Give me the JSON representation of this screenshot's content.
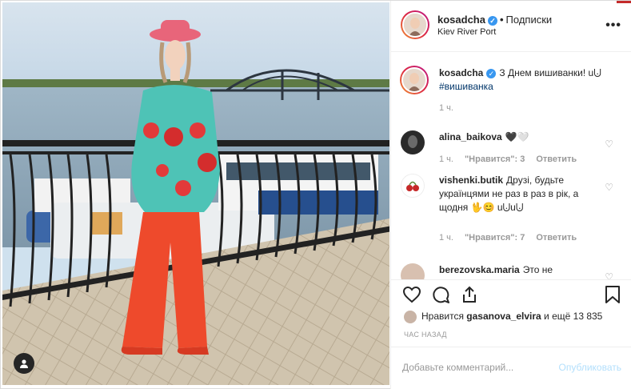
{
  "header": {
    "username": "kosadcha",
    "separator": "•",
    "follow_status": "Подписки",
    "location": "Kiev River Port",
    "more_label": "•••"
  },
  "caption": {
    "username": "kosadcha",
    "text": "З Днем вишиванки! u⨃",
    "hashtag": "#вишиванка",
    "time": "1 ч."
  },
  "comments": [
    {
      "username": "alina_baikova",
      "text": "🖤🤍",
      "time": "1 ч.",
      "likes": "\"Нравится\": 3",
      "reply": "Ответить"
    },
    {
      "username": "vishenki.butik",
      "text": "Друзі, будьте українцями не раз в раз в рік, а щодня 🖖😊 u⨃u⨃",
      "time": "1 ч.",
      "likes": "\"Нравится\": 7",
      "reply": "Ответить"
    },
    {
      "username": "berezovska.maria",
      "text": "Это не"
    }
  ],
  "likes": {
    "prefix": "Нравится",
    "user": "gasanova_elvira",
    "suffix": "и ещё 13 835"
  },
  "time_ago": "ЧАС НАЗАД",
  "add_comment": {
    "placeholder": "Добавьте комментарий...",
    "publish": "Опубликовать"
  },
  "icons": {
    "like": "heart-icon",
    "comment": "comment-icon",
    "share": "share-icon",
    "save": "bookmark-icon",
    "user_tag": "user-icon"
  },
  "colors": {
    "link_blue": "#3897f0",
    "hashtag": "#003569",
    "publish_disabled": "#b2dffc"
  }
}
